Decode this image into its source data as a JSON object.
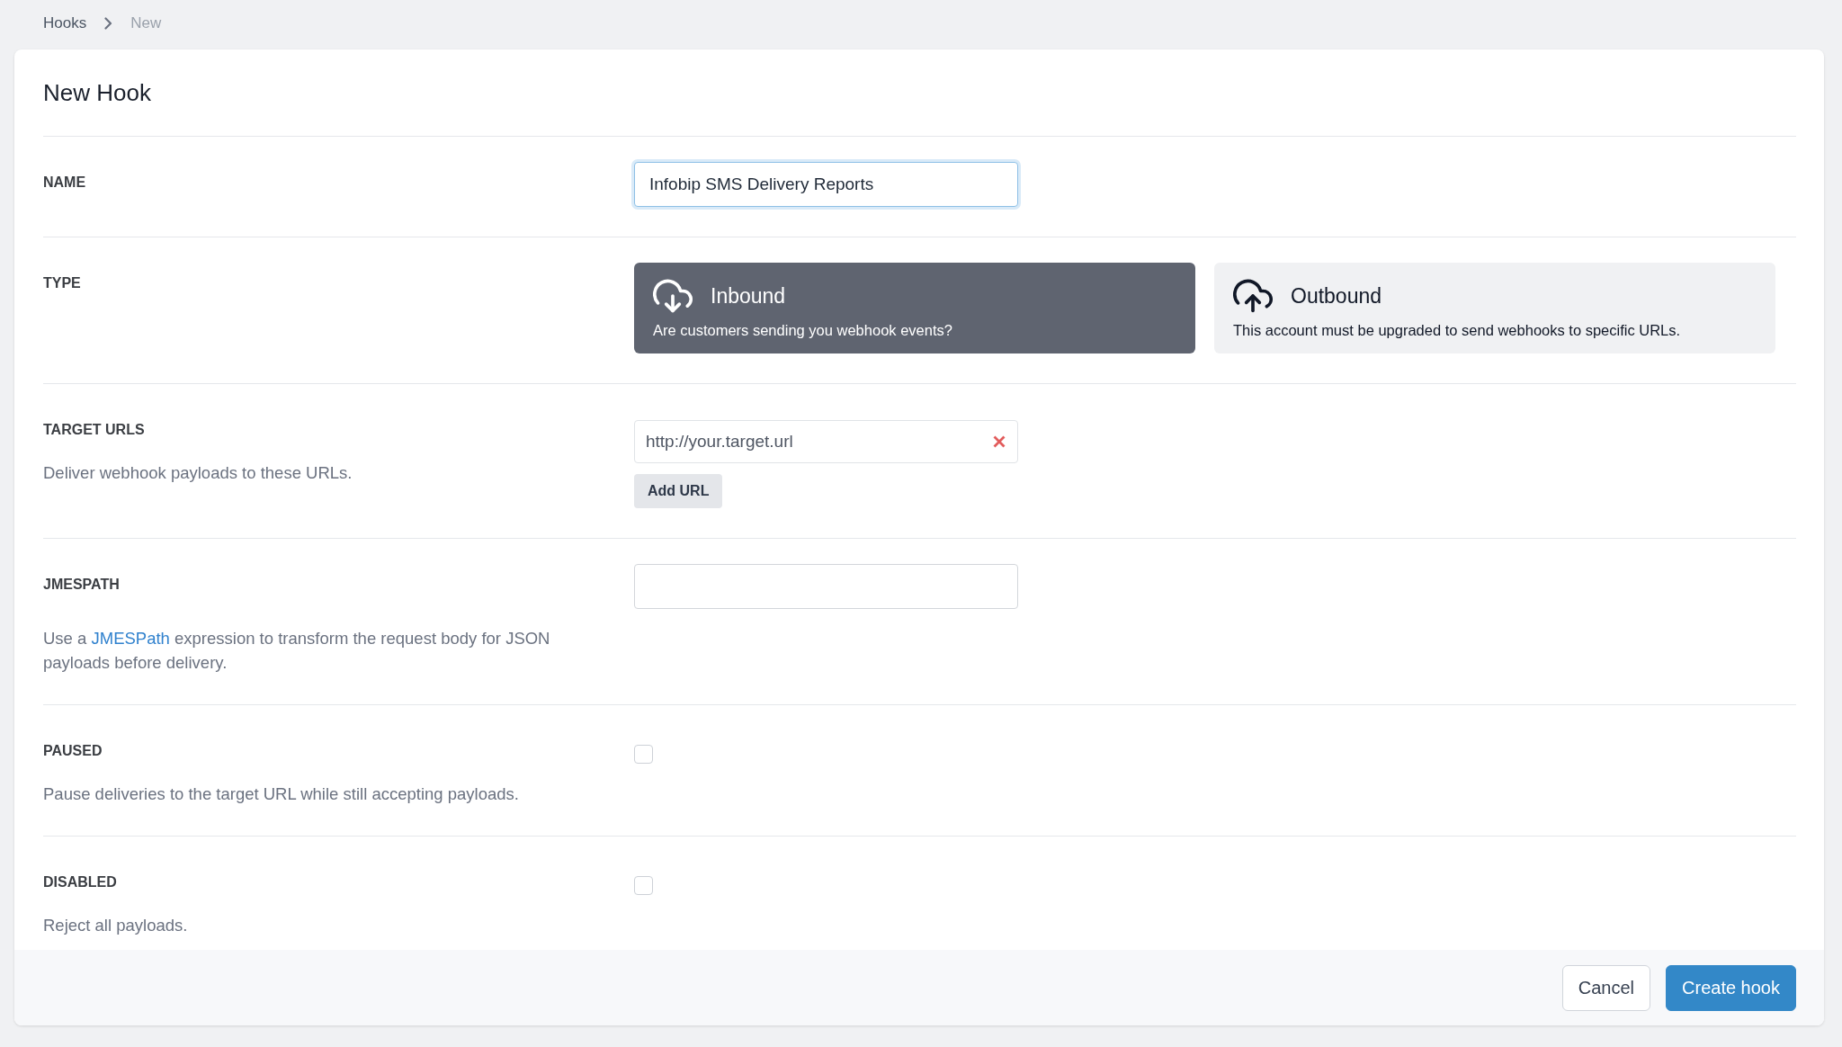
{
  "breadcrumb": [
    {
      "label": "Hooks",
      "current": false
    },
    {
      "label": "New",
      "current": true
    }
  ],
  "title": "New Hook",
  "fields": [
    {
      "kind": "text",
      "label": "NAME",
      "value": "Infobip SMS Delivery Reports",
      "focused": true
    },
    {
      "kind": "type",
      "label": "TYPE",
      "options": [
        {
          "kind": "inbound",
          "title": "Inbound",
          "description": "Are customers sending you webhook events?",
          "selected": true
        },
        {
          "kind": "outbound",
          "title": "Outbound",
          "description": "This account must be upgraded to send webhooks to specific URLs.",
          "selected": false
        }
      ]
    },
    {
      "kind": "urls",
      "label": "TARGET URLS",
      "description": "Deliver webhook payloads to these URLs.",
      "urls": [
        {
          "placeholder": "http://your.target.url"
        }
      ],
      "add_button": "Add URL"
    },
    {
      "kind": "text",
      "label": "JMESPATH",
      "focused": false,
      "description_parts": {
        "before": "Use a ",
        "link": "JMESPath",
        "after": " expression to transform the request body for JSON payloads before delivery."
      }
    },
    {
      "kind": "checkbox",
      "label": "PAUSED",
      "checked": false,
      "description": "Pause deliveries to the target URL while still accepting payloads."
    },
    {
      "kind": "checkbox",
      "label": "DISABLED",
      "checked": false,
      "description": "Reject all payloads."
    }
  ],
  "actions": [
    {
      "label": "Cancel",
      "kind": "secondary"
    },
    {
      "label": "Create hook",
      "kind": "primary"
    }
  ]
}
